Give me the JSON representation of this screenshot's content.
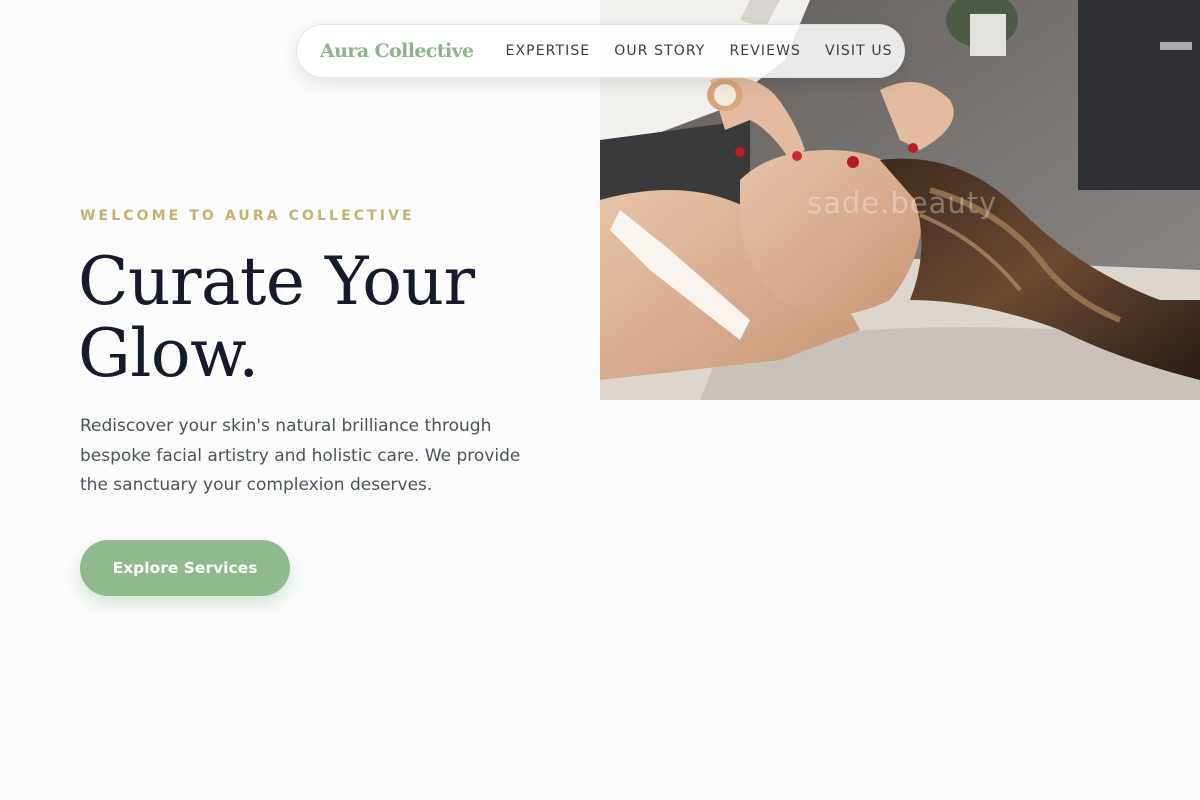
{
  "nav": {
    "brand": "Aura Collective",
    "links": [
      "EXPERTISE",
      "OUR STORY",
      "REVIEWS",
      "VISIT US"
    ]
  },
  "hero": {
    "eyebrow": "WELCOME TO AURA COLLECTIVE",
    "title": "Curate Your Glow.",
    "body": "Rediscover your skin's natural brilliance through bespoke facial artistry and holistic care. We provide the sanctuary your complexion deserves.",
    "cta_label": "Explore Services",
    "image_watermark": "sade.beauty"
  },
  "colors": {
    "brand_green": "#8fb38d",
    "accent_gold": "#c3b270",
    "heading_navy": "#151b2b",
    "body_gray": "#4b5260"
  }
}
